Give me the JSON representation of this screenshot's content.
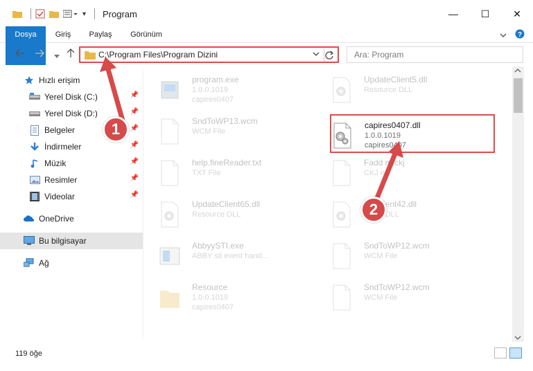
{
  "window": {
    "title": "Program",
    "minimize_glyph": "—",
    "maximize_glyph": "☐",
    "close_glyph": "✕"
  },
  "ribbon": {
    "tabs": [
      "Dosya",
      "Giriş",
      "Paylaş",
      "Görünüm"
    ],
    "accent_color": "#1979ca"
  },
  "address": {
    "path": "C:\\Program Files\\Program Dizini"
  },
  "search": {
    "placeholder": "Ara: Program"
  },
  "sidebar": {
    "items": [
      {
        "label": "Hızlı erişim",
        "icon": "star-icon"
      },
      {
        "label": "Yerel Disk (C:)",
        "icon": "disk-icon"
      },
      {
        "label": "Yerel Disk (D:)",
        "icon": "disk-icon"
      },
      {
        "label": "Belgeler",
        "icon": "documents-icon"
      },
      {
        "label": "İndirmeler",
        "icon": "download-icon"
      },
      {
        "label": "Müzik",
        "icon": "music-icon"
      },
      {
        "label": "Resimler",
        "icon": "pictures-icon"
      },
      {
        "label": "Videolar",
        "icon": "videos-icon"
      },
      {
        "label": "OneDrive",
        "icon": "cloud-icon"
      },
      {
        "label": "Bu bilgisayar",
        "icon": "computer-icon"
      },
      {
        "label": "Ağ",
        "icon": "network-icon"
      }
    ]
  },
  "files": [
    {
      "name": "program.exe",
      "line2": "1.0.0.1019",
      "line3": "capires0407",
      "icon": "exe-icon"
    },
    {
      "name": "UpdateClient5.dll",
      "line2": "Resource DLL",
      "line3": "",
      "icon": "dll-icon"
    },
    {
      "name": "SndToWP13.wcm",
      "line2": "WCM File",
      "line3": "",
      "icon": "file-icon"
    },
    {
      "name": "capires0407.dll",
      "line2": "1.0.0.1019",
      "line3": "capires0407",
      "icon": "dll-icon"
    },
    {
      "name": "help.fineReader.txt",
      "line2": "TXT File",
      "line3": "",
      "icon": "file-icon"
    },
    {
      "name": "Fadd   m.ckj",
      "line2": "CKJ   e",
      "line3": "",
      "icon": "file-icon"
    },
    {
      "name": "UpdateClient65.dll",
      "line2": "Resource DLL",
      "line3": "",
      "icon": "dll-icon"
    },
    {
      "name": "   ateClient42.dll",
      "line2": "   ource DLL",
      "line3": "",
      "icon": "dll-icon"
    },
    {
      "name": "AbbyySTI.exe",
      "line2": "ABBY sti event hand...",
      "line3": "",
      "icon": "app-icon"
    },
    {
      "name": "SndToWP12.wcm",
      "line2": "WCM File",
      "line3": "",
      "icon": "file-icon"
    },
    {
      "name": "Resource",
      "line2": "1.0.0.1019",
      "line3": "capires0407",
      "icon": "folder-icon"
    },
    {
      "name": "SndToWP12.wcm",
      "line2": "WCM File",
      "line3": "",
      "icon": "file-icon"
    }
  ],
  "status": {
    "count": "119 öğe"
  },
  "callouts": {
    "one": "1",
    "two": "2",
    "color": "#d64a4a"
  }
}
